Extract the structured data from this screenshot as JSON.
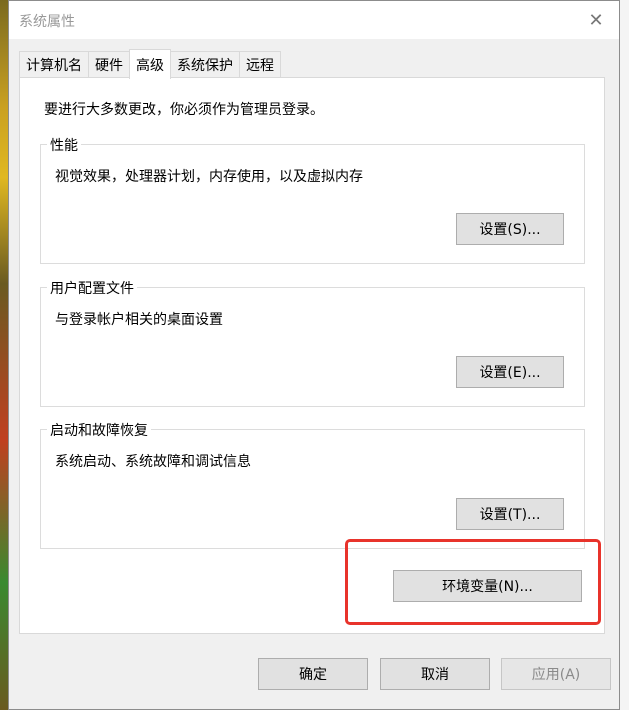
{
  "window": {
    "title": "系统属性",
    "close_glyph": "✕"
  },
  "tabs": [
    {
      "label": "计算机名",
      "active": false
    },
    {
      "label": "硬件",
      "active": false
    },
    {
      "label": "高级",
      "active": true
    },
    {
      "label": "系统保护",
      "active": false
    },
    {
      "label": "远程",
      "active": false
    }
  ],
  "panel": {
    "intro": "要进行大多数更改，你必须作为管理员登录。",
    "groups": [
      {
        "title": "性能",
        "description": "视觉效果，处理器计划，内存使用，以及虚拟内存",
        "button": "设置(S)..."
      },
      {
        "title": "用户配置文件",
        "description": "与登录帐户相关的桌面设置",
        "button": "设置(E)..."
      },
      {
        "title": "启动和故障恢复",
        "description": "系统启动、系统故障和调试信息",
        "button": "设置(T)..."
      }
    ],
    "env_button": "环境变量(N)..."
  },
  "footer": {
    "ok": "确定",
    "cancel": "取消",
    "apply": "应用(A)"
  },
  "colors": {
    "highlight": "#e8332b",
    "panel_bg": "#ffffff",
    "window_bg": "#f0f0f0"
  }
}
